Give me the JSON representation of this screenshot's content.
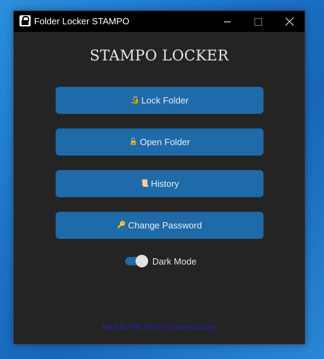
{
  "window": {
    "title": "Folder Locker STAMPO"
  },
  "app": {
    "heading": "STAMPO LOCKER"
  },
  "buttons": [
    {
      "icon": "🔏",
      "label": "Lock Folder"
    },
    {
      "icon": "🔓",
      "label": "Open Folder"
    },
    {
      "icon": "📜",
      "label": "History"
    },
    {
      "icon": "🔑",
      "label": "Change Password"
    }
  ],
  "toggle": {
    "label": "Dark Mode",
    "state": "on"
  },
  "footer": {
    "text": "Made By PRK | Not For Commercial Use"
  },
  "colors": {
    "accent": "#1f6aa8",
    "window_bg": "#242424",
    "titlebar": "#000000",
    "footer_text": "#1f20d8"
  }
}
